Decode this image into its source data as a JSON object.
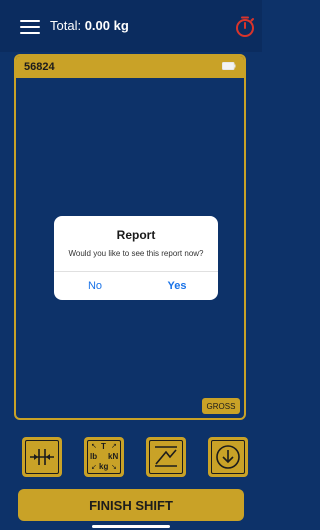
{
  "header": {
    "total_label": "Total:",
    "total_value": "0.00 kg",
    "menu_icon": "hamburger-menu-icon",
    "timer_icon": "stopwatch-icon"
  },
  "panel": {
    "id": "56824",
    "battery_icon": "battery-icon",
    "gross_label": "GROSS"
  },
  "dialog": {
    "title": "Report",
    "message": "Would you like to see this report now?",
    "no_label": "No",
    "yes_label": "Yes"
  },
  "toolbar": {
    "buttons": [
      {
        "name": "zero-icon"
      },
      {
        "name": "units-icon",
        "labels": [
          "T",
          "lb",
          "kN",
          "kg"
        ]
      },
      {
        "name": "chart-icon"
      },
      {
        "name": "download-icon"
      }
    ]
  },
  "finish_label": "FINISH SHIFT",
  "colors": {
    "background": "#0d3269",
    "accent": "#c9a227",
    "timer_red": "#d9342b",
    "link_blue": "#1a73e8"
  }
}
